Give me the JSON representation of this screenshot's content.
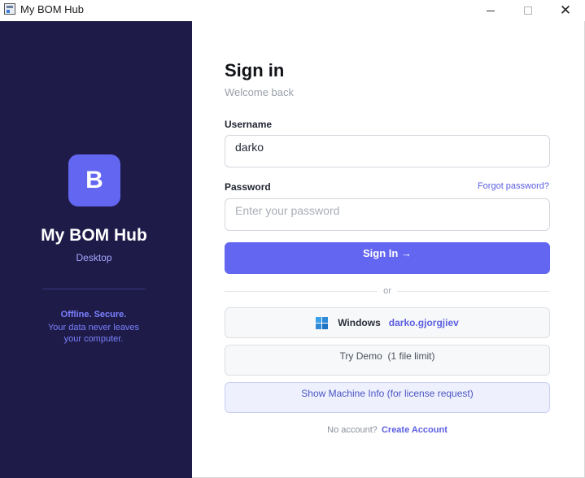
{
  "window": {
    "title": "My BOM Hub",
    "minimize_icon": "minimize-icon",
    "maximize_icon": "maximize-icon",
    "close_icon": "close-icon",
    "close_glyph": "✕"
  },
  "brand": {
    "logo_letter": "B",
    "name": "My BOM Hub",
    "subtitle": "Desktop",
    "tagline_bold": "Offline. Secure.",
    "tagline_rest": "Your data never leaves your computer.",
    "panel_color": "#1e1b48",
    "accent_color": "#6366f1"
  },
  "form": {
    "heading": "Sign in",
    "subheading": "Welcome back",
    "username_label": "Username",
    "username_value": "darko",
    "password_label": "Password",
    "password_placeholder": "Enter your password",
    "forgot_label": "Forgot password?",
    "signin_label": "Sign In →",
    "or_label": "or",
    "windows_label": "Windows",
    "windows_user": "darko.gjorgjiev",
    "windows_icon": "windows-logo-icon",
    "demo_label": "Try Demo  (1 file limit)",
    "machine_info_label": "Show Machine Info (for license request)",
    "no_account_label": "No account?",
    "create_account_label": "Create Account"
  }
}
